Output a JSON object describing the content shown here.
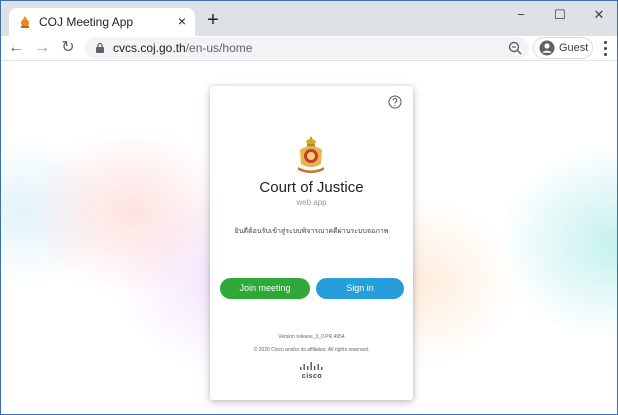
{
  "browser": {
    "tab_title": "COJ Meeting App",
    "tab_close_glyph": "×",
    "new_tab_glyph": "+",
    "url_host": "cvcs.coj.go.th",
    "url_path": "/en-us/home",
    "profile_label": "Guest",
    "window_controls": {
      "minimize": "−",
      "maximize": "☐",
      "close": "✕"
    },
    "nav": {
      "back": "←",
      "forward": "→",
      "reload": "↻"
    },
    "icons": [
      "favicon-emblem-icon",
      "lock-icon",
      "zoom-icon",
      "guest-avatar-icon",
      "more-menu-icon"
    ]
  },
  "card": {
    "title": "Court of Justice",
    "subtitle": "web app",
    "welcome": "ยินดีต้อนรับเข้าสู่ระบบพิจารณาคดีผ่านระบบจอภาพ",
    "join_label": "Join meeting",
    "signin_label": "Sign in",
    "version": "Version release_3_0.PR.4954",
    "copyright": "© 2020 Cisco and/or its affiliates. All rights reserved.",
    "vendor_logo_text": "cisco",
    "icons": [
      "help-icon",
      "court-emblem-icon",
      "cisco-logo"
    ]
  },
  "colors": {
    "join_button": "#2ea838",
    "signin_button": "#259ed9",
    "tabstrip": "#dee1e6"
  }
}
